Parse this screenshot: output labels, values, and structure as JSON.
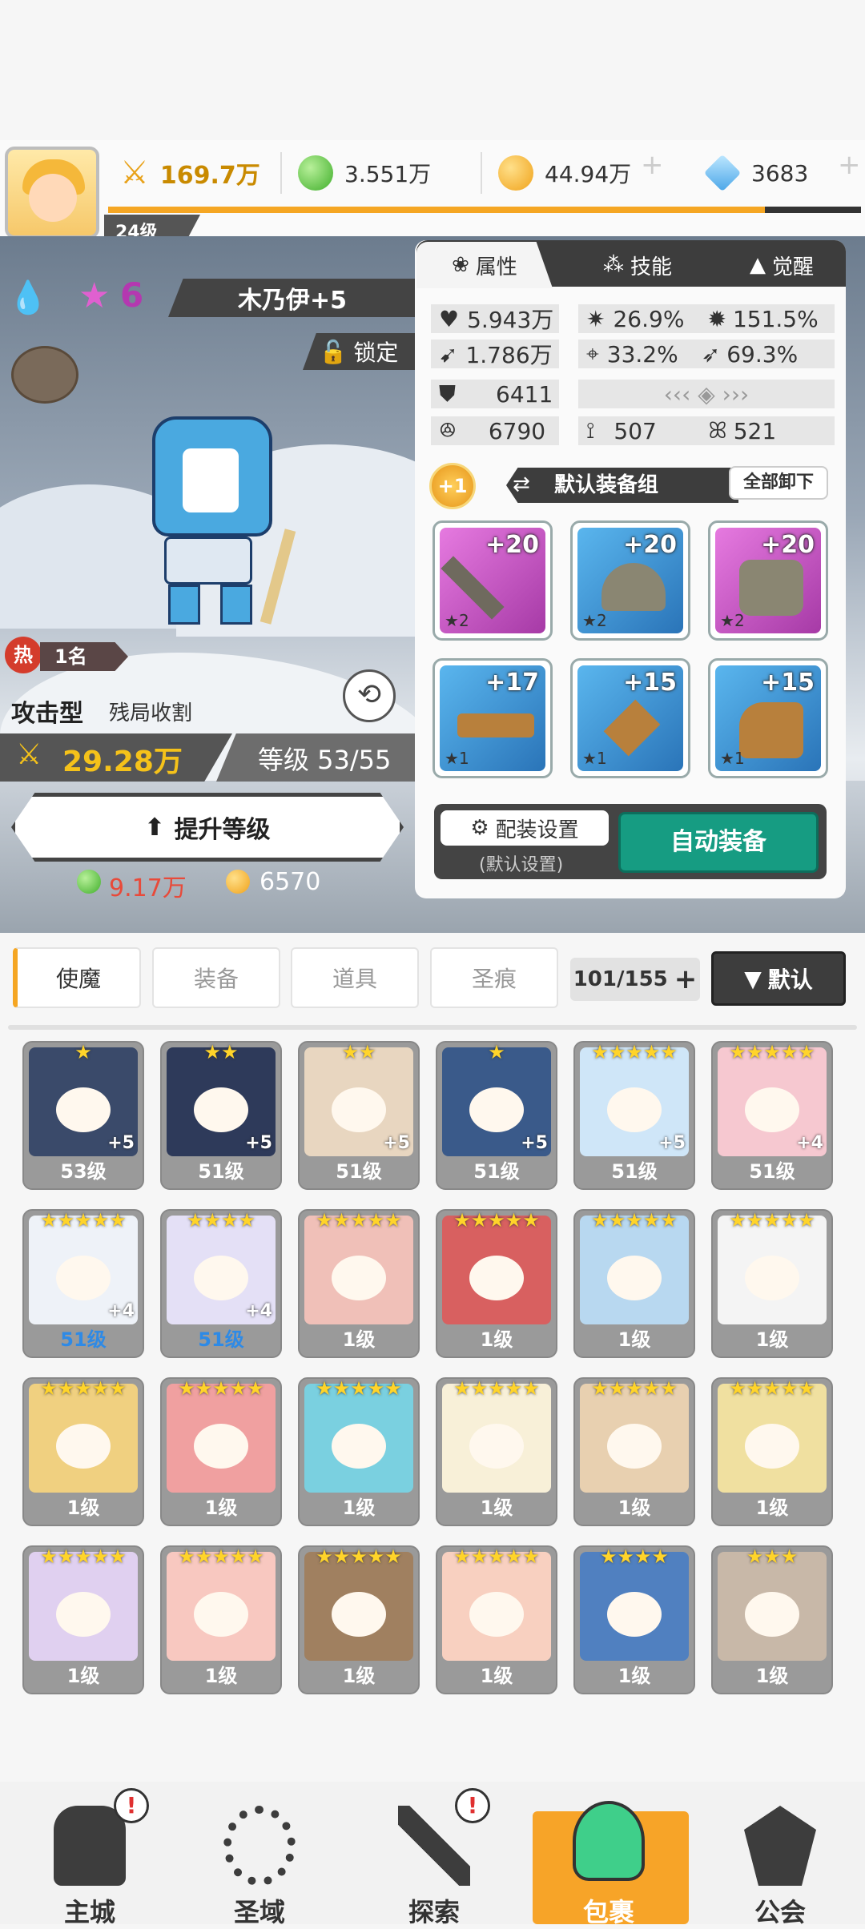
{
  "player": {
    "level": "24级"
  },
  "resources": {
    "power": "169.7万",
    "green_coin": "3.551万",
    "gold": "44.94万",
    "gem": "3683"
  },
  "hero": {
    "name": "木乃伊+5",
    "stars": "6",
    "lock_label": "锁定",
    "hot_rank": "1名",
    "hot_label": "热",
    "type": "攻击型",
    "subtype": "残局收割",
    "power": "29.28万",
    "level_text": "等级 53/55",
    "upgrade_label": "提升等级",
    "cost_green": "9.17万",
    "cost_gold": "6570"
  },
  "panel": {
    "tabs": [
      "属性",
      "技能",
      "觉醒"
    ],
    "stats": {
      "hp": "5.943万",
      "crit": "26.9%",
      "crit_dmg": "151.5%",
      "atk": "1.786万",
      "acc": "33.2%",
      "speed": "69.3%",
      "def": "6411",
      "s1": "6790",
      "s2": "507",
      "s3": "521"
    },
    "plus_badge": "+1",
    "equip_group": "默认装备组",
    "unequip_all": "全部卸下",
    "equipment": [
      {
        "level": "+20",
        "stars": "2"
      },
      {
        "level": "+20",
        "stars": "2"
      },
      {
        "level": "+20",
        "stars": "2"
      },
      {
        "level": "+17",
        "stars": "1"
      },
      {
        "level": "+15",
        "stars": "1"
      },
      {
        "level": "+15",
        "stars": "1"
      }
    ],
    "config_label": "配装设置",
    "config_sub": "(默认设置)",
    "auto_equip": "自动装备"
  },
  "inventory": {
    "tabs": [
      "使魔",
      "装备",
      "道具",
      "圣痕"
    ],
    "count": "101/155",
    "sort_label": "默认",
    "cards": [
      {
        "lv": "53级",
        "stars": "★",
        "plus": "+5"
      },
      {
        "lv": "51级",
        "stars": "★★",
        "plus": "+5"
      },
      {
        "lv": "51级",
        "stars": "★★",
        "plus": "+5"
      },
      {
        "lv": "51级",
        "stars": "★",
        "plus": "+5"
      },
      {
        "lv": "51级",
        "stars": "★★★★★",
        "plus": "+5"
      },
      {
        "lv": "51级",
        "stars": "★★★★★",
        "plus": "+4"
      },
      {
        "lv": "51级",
        "stars": "★★★★★",
        "plus": "+4"
      },
      {
        "lv": "51级",
        "stars": "★★★★",
        "plus": "+4"
      },
      {
        "lv": "1级",
        "stars": "★★★★★",
        "plus": ""
      },
      {
        "lv": "1级",
        "stars": "★★★★★",
        "plus": ""
      },
      {
        "lv": "1级",
        "stars": "★★★★★",
        "plus": ""
      },
      {
        "lv": "1级",
        "stars": "★★★★★",
        "plus": ""
      },
      {
        "lv": "1级",
        "stars": "★★★★★",
        "plus": ""
      },
      {
        "lv": "1级",
        "stars": "★★★★★",
        "plus": ""
      },
      {
        "lv": "1级",
        "stars": "★★★★★",
        "plus": ""
      },
      {
        "lv": "1级",
        "stars": "★★★★★",
        "plus": ""
      },
      {
        "lv": "1级",
        "stars": "★★★★★",
        "plus": ""
      },
      {
        "lv": "1级",
        "stars": "★★★★★",
        "plus": ""
      },
      {
        "lv": "1级",
        "stars": "★★★★★",
        "plus": ""
      },
      {
        "lv": "1级",
        "stars": "★★★★★",
        "plus": ""
      },
      {
        "lv": "1级",
        "stars": "★★★★★",
        "plus": ""
      },
      {
        "lv": "1级",
        "stars": "★★★★★",
        "plus": ""
      },
      {
        "lv": "1级",
        "stars": "★★★★",
        "plus": ""
      },
      {
        "lv": "1级",
        "stars": "★★★",
        "plus": ""
      }
    ]
  },
  "nav": [
    {
      "label": "主城",
      "icon": "castle-icon"
    },
    {
      "label": "圣域",
      "icon": "vortex-icon"
    },
    {
      "label": "探索",
      "icon": "sword-icon"
    },
    {
      "label": "包裹",
      "icon": "bag-icon"
    },
    {
      "label": "公会",
      "icon": "guild-icon"
    }
  ]
}
